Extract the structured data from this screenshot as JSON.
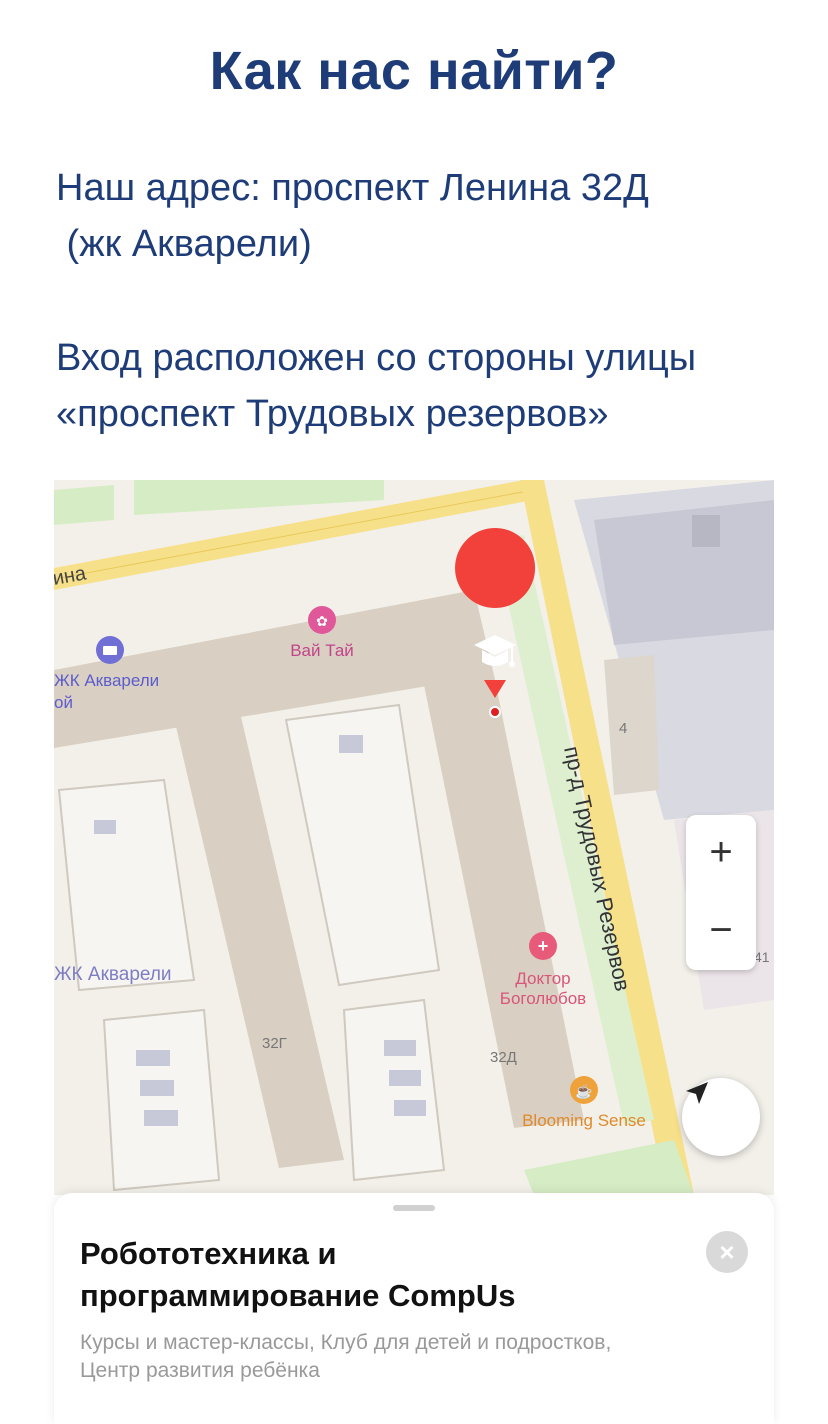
{
  "page": {
    "title": "Как нас найти?",
    "address_line1": "Наш адрес: проспект Ленина 32Д",
    "address_line2": " (жк Акварели)",
    "entrance_line1": "Вход расположен со стороны улицы",
    "entrance_line2": "«проспект Трудовых резервов»"
  },
  "map": {
    "labels": {
      "street_lenina": "ина",
      "street_trudovyh": "пр-д Трудовых Резервов",
      "poi_vai_tai": "Вай Тай",
      "poi_zhk_akvareli_top": "ЖК Акварели",
      "poi_zhk_akvareli_top_sub": "ой",
      "poi_zhk_akvareli_mid": "ЖК Акварели",
      "poi_doctor_line1": "Доктор",
      "poi_doctor_line2": "Боголюбов",
      "poi_blooming": "Blooming Sense",
      "house_32g": "32Г",
      "house_32d": "32Д",
      "house_4": "4",
      "house_41": "41"
    },
    "controls": {
      "zoom_in": "+",
      "zoom_out": "−"
    },
    "icons": {
      "marker": "graduation-cap-icon",
      "locate": "navigation-arrow-icon"
    },
    "colors": {
      "marker": "#f2403a",
      "title": "#1d3c78",
      "road_major": "#f7e08a"
    }
  },
  "sheet": {
    "title_line1": "Робототехника и",
    "title_line2": "программирование CompUs",
    "subtitle_line1": "Курсы и мастер-классы, Клуб для детей и подростков,",
    "subtitle_line2": "Центр развития ребёнка",
    "close": "×"
  }
}
